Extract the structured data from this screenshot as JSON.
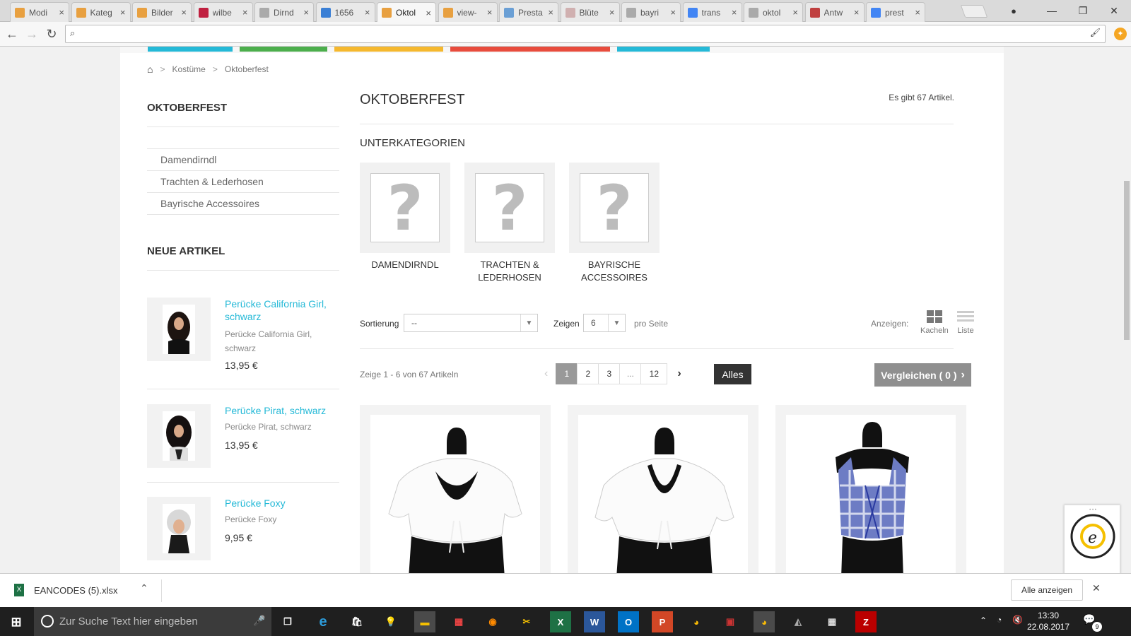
{
  "browser": {
    "tabs": [
      {
        "label": "Modi",
        "color": "#e8a040",
        "active": false
      },
      {
        "label": "Kateg",
        "color": "#e8a040",
        "active": false
      },
      {
        "label": "Bilder",
        "color": "#e8a040",
        "active": false
      },
      {
        "label": "wilbe",
        "color": "#c02040",
        "active": false
      },
      {
        "label": "Dirnd",
        "color": "#aaaaaa",
        "active": false
      },
      {
        "label": "1656",
        "color": "#3a7fd5",
        "active": false
      },
      {
        "label": "Oktol",
        "color": "#e8a040",
        "active": true
      },
      {
        "label": "view-",
        "color": "#e8a040",
        "active": false
      },
      {
        "label": "Presta",
        "color": "#6a9fd5",
        "active": false
      },
      {
        "label": "Blüte",
        "color": "#d0b0b0",
        "active": false
      },
      {
        "label": "bayri",
        "color": "#aaaaaa",
        "active": false
      },
      {
        "label": "trans",
        "color": "#4285f4",
        "active": false
      },
      {
        "label": "oktol",
        "color": "#aaaaaa",
        "active": false
      },
      {
        "label": "Antw",
        "color": "#c04040",
        "active": false
      },
      {
        "label": "prest",
        "color": "#4285f4",
        "active": false
      }
    ],
    "tab_close": "×",
    "address_value": "",
    "window_controls": {
      "minimize": "—",
      "restore": "❐",
      "close": "✕"
    }
  },
  "breadcrumb": {
    "items": [
      "Kostüme",
      "Oktoberfest"
    ],
    "separator": ">"
  },
  "sidebar": {
    "category_title": "OKTOBERFEST",
    "categories": [
      "Damendirndl",
      "Trachten & Lederhosen",
      "Bayrische Accessoires"
    ],
    "new_title": "NEUE ARTIKEL",
    "new_products": [
      {
        "name": "Perücke California Girl, schwarz",
        "desc": "Perücke California Girl, schwarz",
        "price": "13,95 €"
      },
      {
        "name": "Perücke Pirat, schwarz",
        "desc": "Perücke Pirat, schwarz",
        "price": "13,95 €"
      },
      {
        "name": "Perücke Foxy",
        "desc": "Perücke Foxy",
        "price": "9,95 €"
      }
    ]
  },
  "main": {
    "title": "OKTOBERFEST",
    "count_text": "Es gibt 67 Artikel.",
    "subcat_heading": "UNTERKATEGORIEN",
    "subcategories": [
      {
        "line1": "DAMENDIRNDL",
        "line2": ""
      },
      {
        "line1": "TRACHTEN &",
        "line2": "LEDERHOSEN"
      },
      {
        "line1": "BAYRISCHE",
        "line2": "ACCESSOIRES"
      }
    ],
    "sort_label": "Sortierung",
    "sort_value": "--",
    "show_label": "Zeigen",
    "show_value": "6",
    "per_page": "pro Seite",
    "view_label": "Anzeigen:",
    "view_grid": "Kacheln",
    "view_list": "Liste",
    "showing_text": "Zeige 1 - 6 von 67 Artikeln",
    "pages": [
      "1",
      "2",
      "3",
      "...",
      "12"
    ],
    "all_button": "Alles",
    "compare_button": "Vergleichen ( 0 )"
  },
  "download_bar": {
    "file": "EANCODES (5).xlsx",
    "show_all": "Alle anzeigen"
  },
  "taskbar": {
    "search_placeholder": "Zur Suche Text hier eingeben",
    "time": "13:30",
    "date": "22.08.2017",
    "notifications": "9"
  },
  "colors": {
    "accent": "#25b9d7",
    "bar1": "#25b9d7",
    "bar2": "#4cae4c",
    "bar3": "#f5b82e",
    "bar4": "#e84c3d",
    "bar5": "#25b9d7"
  }
}
